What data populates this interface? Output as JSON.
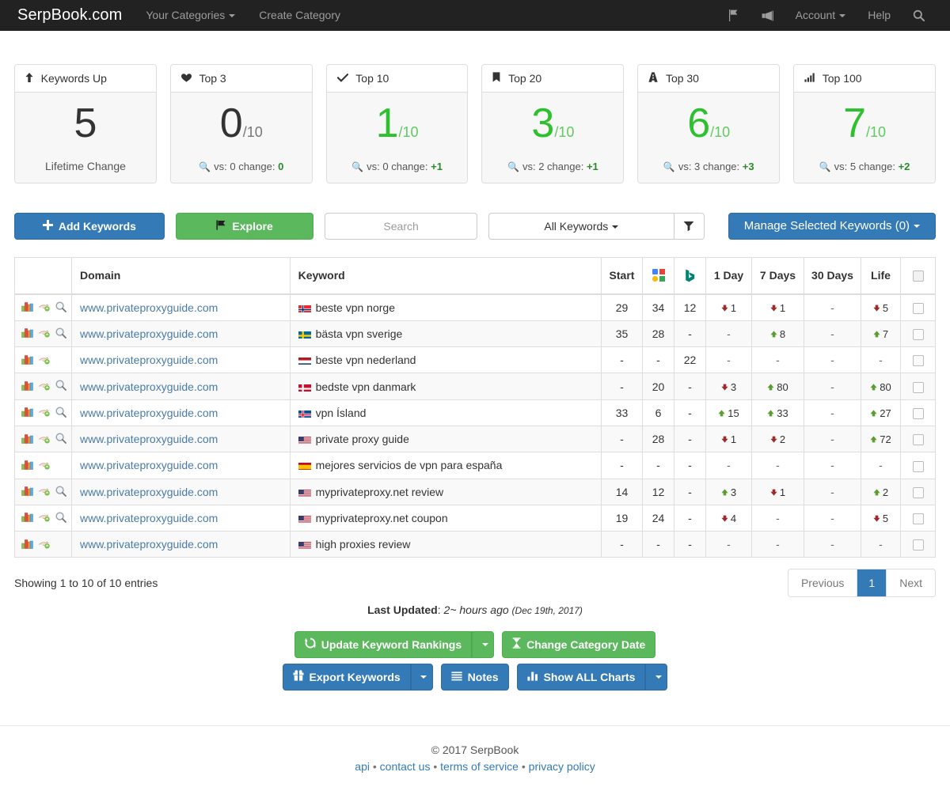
{
  "navbar": {
    "brand": "SerpBook.com",
    "items": [
      {
        "label": "Your Categories",
        "caret": true
      },
      {
        "label": "Create Category",
        "caret": false
      }
    ],
    "right": [
      {
        "label": "",
        "icon": "flag-icon"
      },
      {
        "label": "",
        "icon": "megaphone-icon"
      },
      {
        "label": "Account",
        "icon": "",
        "caret": true
      },
      {
        "label": "Help",
        "icon": ""
      },
      {
        "label": "",
        "icon": "search-icon"
      }
    ]
  },
  "cards": [
    {
      "icon": "arrow-up-icon",
      "title": "Keywords Up",
      "value": "5",
      "denom": "",
      "green": false,
      "foot_text": "Lifetime Change",
      "foot_change": "",
      "has_mag": false
    },
    {
      "icon": "heart-icon",
      "title": "Top 3",
      "value": "0",
      "denom": "/10",
      "green": false,
      "foot_text": "vs: 0 change: ",
      "foot_change": "0",
      "has_mag": true
    },
    {
      "icon": "check-icon",
      "title": "Top 10",
      "value": "1",
      "denom": "/10",
      "green": true,
      "foot_text": "vs: 0 change: ",
      "foot_change": "+1",
      "has_mag": true
    },
    {
      "icon": "bookmark-icon",
      "title": "Top 20",
      "value": "3",
      "denom": "/10",
      "green": true,
      "foot_text": "vs: 2 change: ",
      "foot_change": "+1",
      "has_mag": true
    },
    {
      "icon": "road-icon",
      "title": "Top 30",
      "value": "6",
      "denom": "/10",
      "green": true,
      "foot_text": "vs: 3 change: ",
      "foot_change": "+3",
      "has_mag": true
    },
    {
      "icon": "signal-icon",
      "title": "Top 100",
      "value": "7",
      "denom": "/10",
      "green": true,
      "foot_text": "vs: 5 change: ",
      "foot_change": "+2",
      "has_mag": true
    }
  ],
  "toolbar": {
    "add_keywords": "Add Keywords",
    "explore": "Explore",
    "search_placeholder": "Search",
    "search_value": "",
    "all_keywords": "All Keywords",
    "filter_icon": "funnel-icon",
    "manage": "Manage Selected Keywords (0)"
  },
  "table": {
    "headers": {
      "domain": "Domain",
      "keyword": "Keyword",
      "start": "Start",
      "google": "google-icon",
      "bing": "bing-icon",
      "day1": "1 Day",
      "day7": "7 Days",
      "day30": "30 Days",
      "life": "Life"
    },
    "rows": [
      {
        "domain": "www.privateproxyguide.com",
        "keyword": "beste vpn norge",
        "flag": "no",
        "has_magnifier": true,
        "start": "29",
        "google": "34",
        "bing": "12",
        "d1": {
          "dir": "down",
          "val": "1"
        },
        "d7": {
          "dir": "down",
          "val": "1"
        },
        "d30": {
          "dir": "none",
          "val": "-"
        },
        "life": {
          "dir": "down",
          "val": "5"
        }
      },
      {
        "domain": "www.privateproxyguide.com",
        "keyword": "bästa vpn sverige",
        "flag": "se",
        "has_magnifier": true,
        "start": "35",
        "google": "28",
        "bing": "-",
        "d1": {
          "dir": "none",
          "val": "-"
        },
        "d7": {
          "dir": "up",
          "val": "8"
        },
        "d30": {
          "dir": "none",
          "val": "-"
        },
        "life": {
          "dir": "up",
          "val": "7"
        }
      },
      {
        "domain": "www.privateproxyguide.com",
        "keyword": "beste vpn nederland",
        "flag": "nl",
        "has_magnifier": false,
        "start": "-",
        "google": "-",
        "bing": "22",
        "d1": {
          "dir": "none",
          "val": "-"
        },
        "d7": {
          "dir": "none",
          "val": "-"
        },
        "d30": {
          "dir": "none",
          "val": "-"
        },
        "life": {
          "dir": "none",
          "val": "-"
        }
      },
      {
        "domain": "www.privateproxyguide.com",
        "keyword": "bedste vpn danmark",
        "flag": "dk",
        "has_magnifier": true,
        "start": "-",
        "google": "20",
        "bing": "-",
        "d1": {
          "dir": "down",
          "val": "3"
        },
        "d7": {
          "dir": "up",
          "val": "80"
        },
        "d30": {
          "dir": "none",
          "val": "-"
        },
        "life": {
          "dir": "up",
          "val": "80"
        }
      },
      {
        "domain": "www.privateproxyguide.com",
        "keyword": "vpn Ísland",
        "flag": "is",
        "has_magnifier": true,
        "start": "33",
        "google": "6",
        "bing": "-",
        "d1": {
          "dir": "up",
          "val": "15"
        },
        "d7": {
          "dir": "up",
          "val": "33"
        },
        "d30": {
          "dir": "none",
          "val": "-"
        },
        "life": {
          "dir": "up",
          "val": "27"
        }
      },
      {
        "domain": "www.privateproxyguide.com",
        "keyword": "private proxy guide",
        "flag": "us",
        "has_magnifier": true,
        "start": "-",
        "google": "28",
        "bing": "-",
        "d1": {
          "dir": "down",
          "val": "1"
        },
        "d7": {
          "dir": "down",
          "val": "2"
        },
        "d30": {
          "dir": "none",
          "val": "-"
        },
        "life": {
          "dir": "up",
          "val": "72"
        }
      },
      {
        "domain": "www.privateproxyguide.com",
        "keyword": "mejores servicios de vpn para españa",
        "flag": "es",
        "has_magnifier": false,
        "start": "-",
        "google": "-",
        "bing": "-",
        "d1": {
          "dir": "none",
          "val": "-"
        },
        "d7": {
          "dir": "none",
          "val": "-"
        },
        "d30": {
          "dir": "none",
          "val": "-"
        },
        "life": {
          "dir": "none",
          "val": "-"
        }
      },
      {
        "domain": "www.privateproxyguide.com",
        "keyword": "myprivateproxy.net review",
        "flag": "us",
        "has_magnifier": true,
        "start": "14",
        "google": "12",
        "bing": "-",
        "d1": {
          "dir": "up",
          "val": "3"
        },
        "d7": {
          "dir": "down",
          "val": "1"
        },
        "d30": {
          "dir": "none",
          "val": "-"
        },
        "life": {
          "dir": "up",
          "val": "2"
        }
      },
      {
        "domain": "www.privateproxyguide.com",
        "keyword": "myprivateproxy.net coupon",
        "flag": "us",
        "has_magnifier": true,
        "start": "19",
        "google": "24",
        "bing": "-",
        "d1": {
          "dir": "down",
          "val": "4"
        },
        "d7": {
          "dir": "none",
          "val": "-"
        },
        "d30": {
          "dir": "none",
          "val": "-"
        },
        "life": {
          "dir": "down",
          "val": "5"
        }
      },
      {
        "domain": "www.privateproxyguide.com",
        "keyword": "high proxies review",
        "flag": "us",
        "has_magnifier": false,
        "start": "-",
        "google": "-",
        "bing": "-",
        "d1": {
          "dir": "none",
          "val": "-"
        },
        "d7": {
          "dir": "none",
          "val": "-"
        },
        "d30": {
          "dir": "none",
          "val": "-"
        },
        "life": {
          "dir": "none",
          "val": "-"
        }
      }
    ]
  },
  "below": {
    "showing": "Showing 1 to 10 of 10 entries",
    "pagination": {
      "previous": "Previous",
      "page": "1",
      "next": "Next"
    },
    "last_updated_label": "Last Updated",
    "last_updated_value": "2~ hours ago",
    "last_updated_date": "(Dec 19th, 2017)"
  },
  "actions": {
    "update_rankings": "Update Keyword Rankings",
    "change_category_date": "Change Category Date",
    "export_keywords": "Export Keywords",
    "notes": "Notes",
    "show_all_charts": "Show ALL Charts"
  },
  "footer": {
    "copyright": "© 2017 SerpBook",
    "links": [
      "api",
      "contact us",
      "terms of service",
      "privacy policy"
    ],
    "separator": "•"
  },
  "colors": {
    "navbar_bg": "#222222",
    "primary": "#337ab7",
    "success": "#5cb85c",
    "green_stat": "#2fc02f",
    "up_arrow": "#5a9e2f",
    "down_arrow": "#9d2b2b",
    "link": "#4a7ba8"
  }
}
